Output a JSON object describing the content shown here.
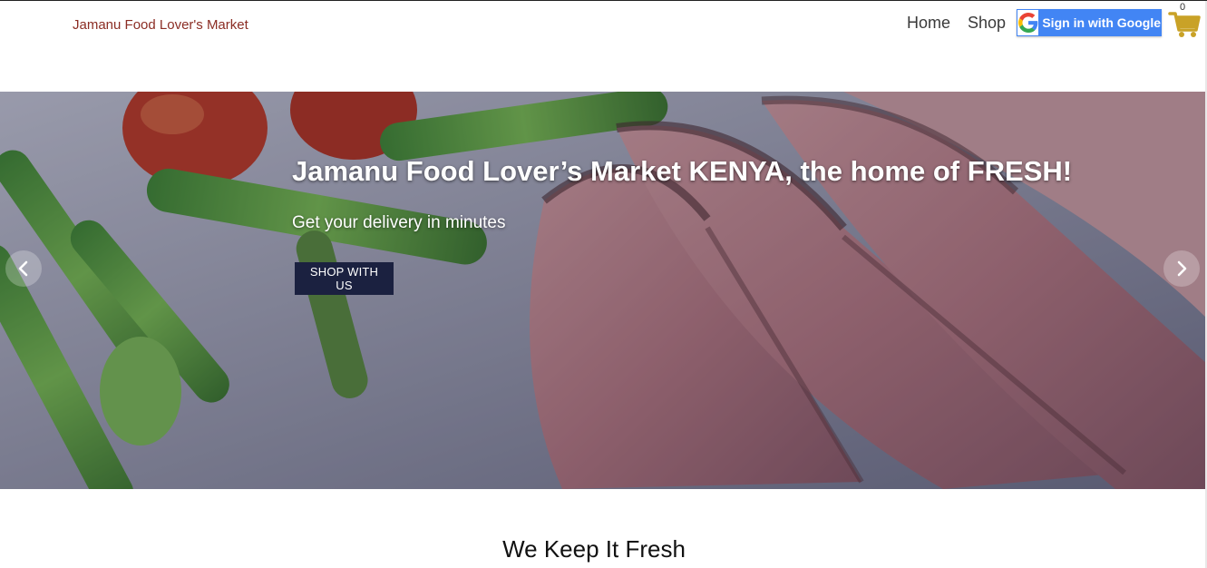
{
  "navbar": {
    "brand": "Jamanu Food Lover's Market",
    "links": [
      {
        "label": "Home"
      },
      {
        "label": "Shop"
      }
    ],
    "google_signin_label": "Sign in with Google",
    "cart": {
      "count": "0",
      "icon": "shopping-cart-icon",
      "color": "#c9a227"
    }
  },
  "hero": {
    "title": "Jamanu Food Lover’s Market KENYA, the home of FRESH!",
    "subtitle": "Get your delivery in minutes",
    "button_label": "SHOP WITH US",
    "prev_icon": "chevron-left-icon",
    "next_icon": "chevron-right-icon"
  },
  "section": {
    "title": "We Keep It Fresh"
  },
  "colors": {
    "brand": "#8b2d24",
    "google_blue": "#4285f4",
    "hero_button": "#1b2140"
  }
}
